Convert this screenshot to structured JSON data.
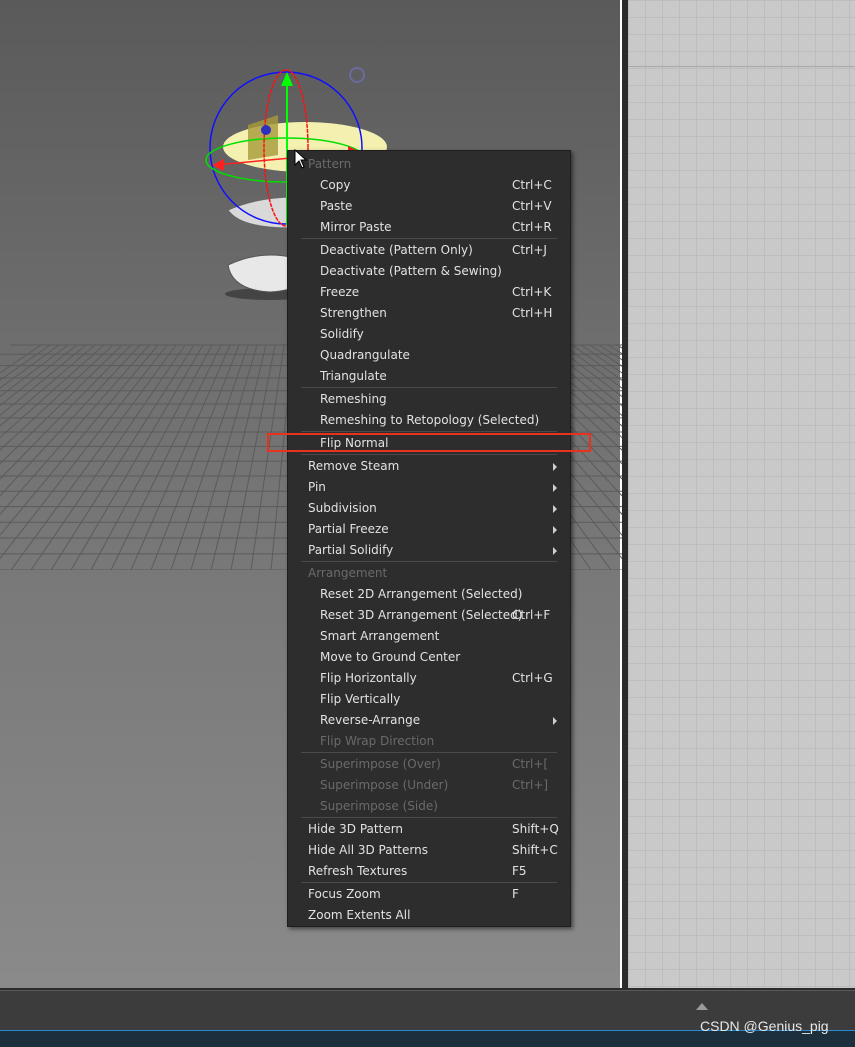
{
  "menu": {
    "groups": [
      {
        "header": "Pattern",
        "items": [
          {
            "label": "Copy",
            "shortcut": "Ctrl+C"
          },
          {
            "label": "Paste",
            "shortcut": "Ctrl+V"
          },
          {
            "label": "Mirror Paste",
            "shortcut": "Ctrl+R"
          }
        ]
      },
      {
        "items": [
          {
            "label": "Deactivate (Pattern Only)",
            "shortcut": "Ctrl+J"
          },
          {
            "label": "Deactivate (Pattern & Sewing)",
            "shortcut": ""
          },
          {
            "label": "Freeze",
            "shortcut": "Ctrl+K"
          },
          {
            "label": "Strengthen",
            "shortcut": "Ctrl+H"
          },
          {
            "label": "Solidify",
            "shortcut": ""
          },
          {
            "label": "Quadrangulate",
            "shortcut": ""
          },
          {
            "label": "Triangulate",
            "shortcut": ""
          }
        ]
      },
      {
        "items": [
          {
            "label": "Remeshing",
            "shortcut": ""
          },
          {
            "label": "Remeshing to Retopology (Selected)",
            "shortcut": ""
          }
        ]
      },
      {
        "items": [
          {
            "label": "Flip Normal",
            "shortcut": "",
            "highlighted": true
          }
        ]
      },
      {
        "items": [
          {
            "label": "Remove Steam",
            "top": true,
            "submenu": true
          },
          {
            "label": "Pin",
            "top": true,
            "submenu": true
          },
          {
            "label": "Subdivision",
            "top": true,
            "submenu": true
          },
          {
            "label": "Partial Freeze",
            "top": true,
            "submenu": true
          },
          {
            "label": "Partial Solidify",
            "top": true,
            "submenu": true
          }
        ]
      },
      {
        "header": "Arrangement",
        "items": [
          {
            "label": "Reset 2D Arrangement (Selected)",
            "shortcut": ""
          },
          {
            "label": "Reset 3D Arrangement (Selected)",
            "shortcut": "Ctrl+F"
          },
          {
            "label": "Smart Arrangement",
            "shortcut": ""
          },
          {
            "label": "Move to Ground Center",
            "shortcut": ""
          },
          {
            "label": "Flip Horizontally",
            "shortcut": "Ctrl+G"
          },
          {
            "label": "Flip Vertically",
            "shortcut": ""
          },
          {
            "label": "Reverse-Arrange",
            "submenu": true
          },
          {
            "label": "Flip Wrap Direction",
            "disabled": true
          }
        ]
      },
      {
        "items": [
          {
            "label": "Superimpose (Over)",
            "shortcut": "Ctrl+[",
            "disabled": true
          },
          {
            "label": "Superimpose (Under)",
            "shortcut": "Ctrl+]",
            "disabled": true
          },
          {
            "label": "Superimpose (Side)",
            "disabled": true
          }
        ]
      },
      {
        "items": [
          {
            "label": "Hide 3D Pattern",
            "shortcut": "Shift+Q",
            "top": true
          },
          {
            "label": "Hide All 3D Patterns",
            "shortcut": "Shift+C",
            "top": true
          },
          {
            "label": "Refresh Textures",
            "shortcut": "F5",
            "top": true
          }
        ]
      },
      {
        "items": [
          {
            "label": "Focus Zoom",
            "shortcut": "F",
            "top": true
          },
          {
            "label": "Zoom Extents All",
            "top": true
          }
        ]
      }
    ]
  },
  "watermark": "CSDN @Genius_pig",
  "colors": {
    "menu_bg": "#2d2d2d",
    "highlight": "#e8321e",
    "gizmo_x": "#ff0000",
    "gizmo_y": "#00ff00",
    "gizmo_z": "#0000ff"
  }
}
